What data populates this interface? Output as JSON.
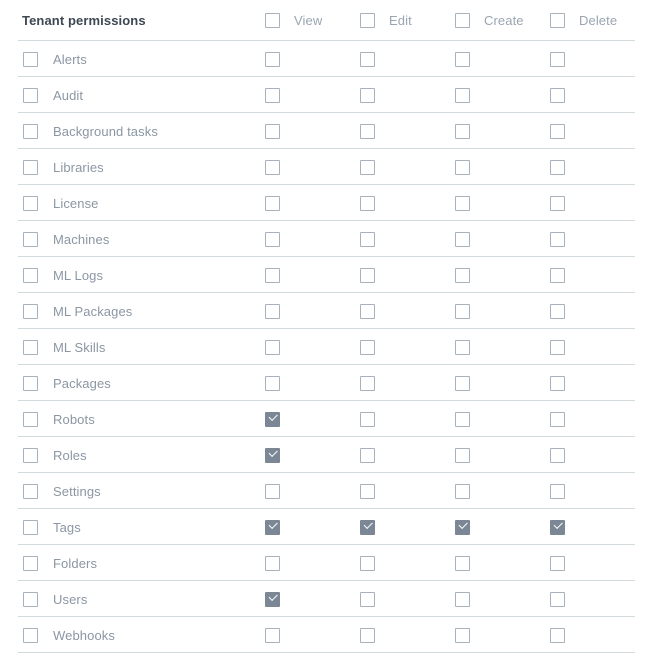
{
  "table": {
    "title": "Tenant permissions",
    "columns": [
      "View",
      "Edit",
      "Create",
      "Delete"
    ],
    "colors": {
      "title_text": "#3d4852",
      "row_label_text": "#8b97a3",
      "column_header_text": "#9aa5b1",
      "separator": "#d3dade",
      "checkbox_border": "#a8b2bd",
      "checkbox_checked_fill": "#7b8794",
      "checkmark": "#ffffff",
      "background": "#ffffff"
    },
    "header_select_all": {
      "view": false,
      "edit": false,
      "create": false,
      "delete": false
    },
    "rows": [
      {
        "label": "Alerts",
        "selected": false,
        "view": false,
        "edit": false,
        "create": false,
        "delete": false
      },
      {
        "label": "Audit",
        "selected": false,
        "view": false,
        "edit": false,
        "create": false,
        "delete": false
      },
      {
        "label": "Background tasks",
        "selected": false,
        "view": false,
        "edit": false,
        "create": false,
        "delete": false
      },
      {
        "label": "Libraries",
        "selected": false,
        "view": false,
        "edit": false,
        "create": false,
        "delete": false
      },
      {
        "label": "License",
        "selected": false,
        "view": false,
        "edit": false,
        "create": false,
        "delete": false
      },
      {
        "label": "Machines",
        "selected": false,
        "view": false,
        "edit": false,
        "create": false,
        "delete": false
      },
      {
        "label": "ML Logs",
        "selected": false,
        "view": false,
        "edit": false,
        "create": false,
        "delete": false
      },
      {
        "label": "ML Packages",
        "selected": false,
        "view": false,
        "edit": false,
        "create": false,
        "delete": false
      },
      {
        "label": "ML Skills",
        "selected": false,
        "view": false,
        "edit": false,
        "create": false,
        "delete": false
      },
      {
        "label": "Packages",
        "selected": false,
        "view": false,
        "edit": false,
        "create": false,
        "delete": false
      },
      {
        "label": "Robots",
        "selected": false,
        "view": true,
        "edit": false,
        "create": false,
        "delete": false
      },
      {
        "label": "Roles",
        "selected": false,
        "view": true,
        "edit": false,
        "create": false,
        "delete": false
      },
      {
        "label": "Settings",
        "selected": false,
        "view": false,
        "edit": false,
        "create": false,
        "delete": false
      },
      {
        "label": "Tags",
        "selected": false,
        "view": true,
        "edit": true,
        "create": true,
        "delete": true
      },
      {
        "label": "Folders",
        "selected": false,
        "view": false,
        "edit": false,
        "create": false,
        "delete": false
      },
      {
        "label": "Users",
        "selected": false,
        "view": true,
        "edit": false,
        "create": false,
        "delete": false
      },
      {
        "label": "Webhooks",
        "selected": false,
        "view": false,
        "edit": false,
        "create": false,
        "delete": false
      }
    ]
  }
}
